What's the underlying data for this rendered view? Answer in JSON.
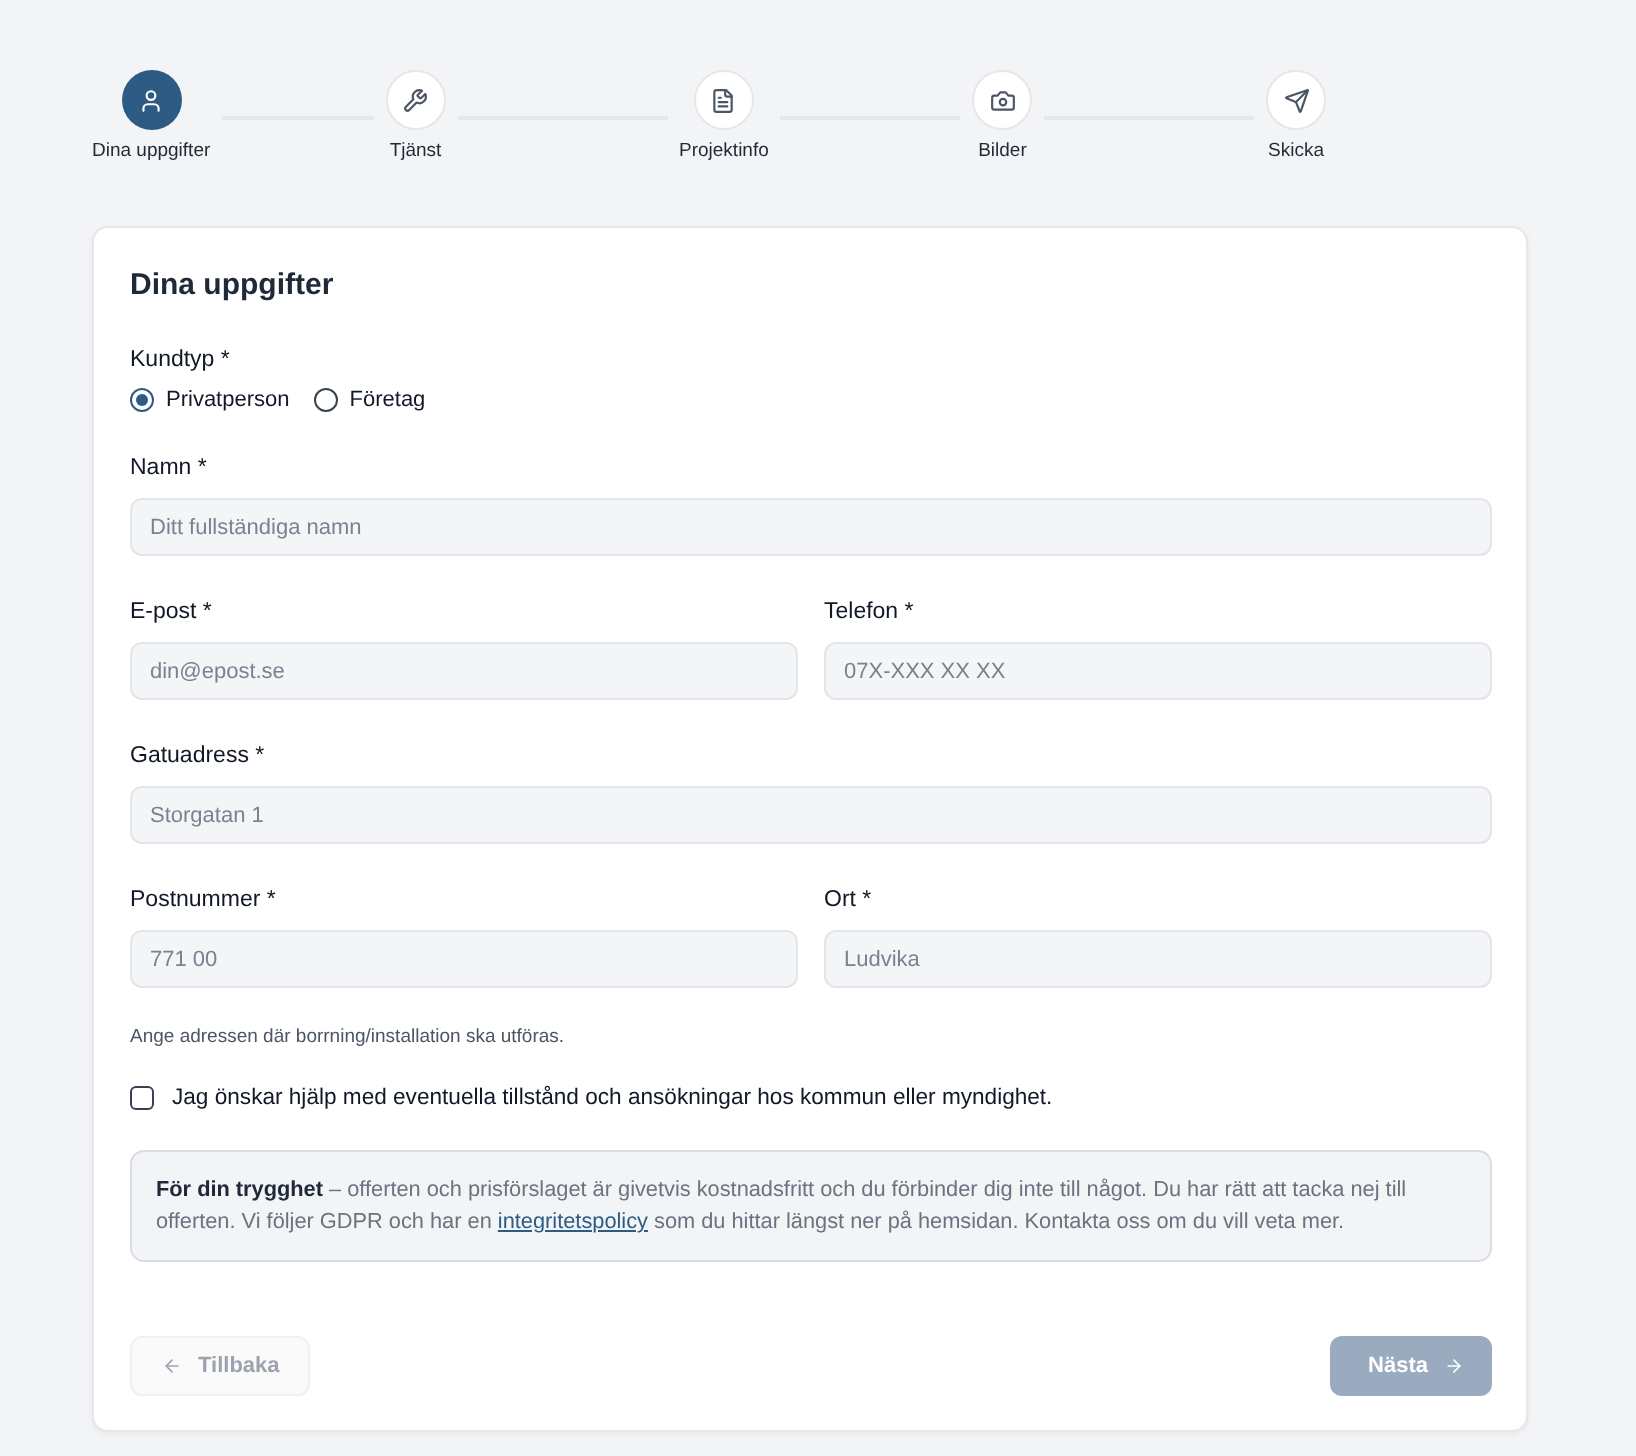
{
  "steps": [
    {
      "label": "Dina uppgifter",
      "selected": true
    },
    {
      "label": "Tjänst",
      "selected": false
    },
    {
      "label": "Projektinfo",
      "selected": false
    },
    {
      "label": "Bilder",
      "selected": false
    },
    {
      "label": "Skicka",
      "selected": false
    }
  ],
  "form": {
    "title": "Dina uppgifter",
    "customer_type": {
      "label": "Kundtyp *",
      "options": [
        {
          "label": "Privatperson",
          "selected": true
        },
        {
          "label": "Företag",
          "selected": false
        }
      ]
    },
    "rows": [
      {
        "fields": [
          {
            "label": "Namn *",
            "placeholder": "Ditt fullständiga namn"
          }
        ]
      },
      {
        "fields": [
          {
            "label": "E-post *",
            "placeholder": "din@epost.se"
          },
          {
            "label": "Telefon *",
            "placeholder": "07X-XXX XX XX"
          }
        ]
      },
      {
        "fields": [
          {
            "label": "Gatuadress *",
            "placeholder": "Storgatan 1"
          }
        ]
      },
      {
        "fields": [
          {
            "label": "Postnummer *",
            "placeholder": "771 00"
          },
          {
            "label": "Ort *",
            "placeholder": "Ludvika"
          }
        ]
      }
    ],
    "address_hint": "Ange adressen där borrning/installation ska utföras.",
    "permit_help": {
      "label": "Jag önskar hjälp med eventuella tillstånd och ansökningar hos kommun eller myndighet.",
      "checked": false
    },
    "notice": {
      "text_before": "**För din trygghet** – offerten och prisförslaget är givetvis kostnadsfritt och du förbinder dig inte till något. Du har rätt att tacka nej till offerten. Vi följer GDPR och har en ",
      "link": "integritetspolicy",
      "text_after": " som du hittar längst ner på hemsidan. Kontakta oss om du vill veta mer."
    },
    "buttons": [
      {
        "kind": "back",
        "label": "Tillbaka",
        "disabled": true
      },
      {
        "kind": "next",
        "label": "Nästa",
        "disabled": true
      }
    ]
  }
}
